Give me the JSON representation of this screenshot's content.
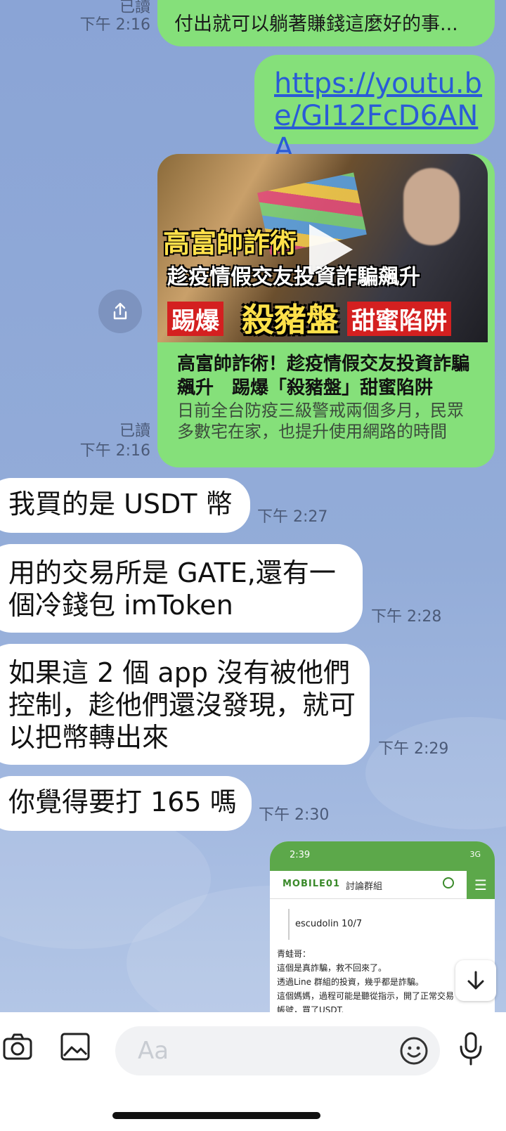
{
  "messages": {
    "m1": {
      "text": "付出就可以躺著賺錢這麼好的事...",
      "read": "已讀",
      "time": "下午 2:16"
    },
    "m2": {
      "link": "https://youtu.be/GI12FcD6ANA"
    },
    "m3": {
      "thumb_title1": "高富帥詐術",
      "thumb_title2": "趁疫情假交友投資詐騙飆升",
      "thumb_title3a": "踢爆",
      "thumb_title3b": "殺豬盤",
      "thumb_title3c": "甜蜜陷阱",
      "title": "高富帥詐術！趁疫情假交友投資詐騙飆升　踢爆「殺豬盤」甜蜜陷阱",
      "desc": "日前全台防疫三級警戒兩個多月，民眾多數宅在家，也提升使用網路的時間",
      "read": "已讀",
      "time": "下午 2:16"
    },
    "m4": {
      "text": "我買的是 USDT 幣",
      "time": "下午 2:27"
    },
    "m5": {
      "text": "用的交易所是 GATE,還有一個冷錢包 imToken",
      "time": "下午 2:28"
    },
    "m6": {
      "text": "如果這 2 個 app 沒有被他們控制，趁他們還沒發現，就可以把幣轉出來",
      "time": "下午 2:29"
    },
    "m7": {
      "text": "你覺得要打 165 嗎",
      "time": "下午 2:30"
    },
    "m8": {
      "status_time": "2:39",
      "status_signal": "3G",
      "site_logo": "MOBILE01",
      "site_section": "討論群組",
      "author": "escudolin 10/7",
      "lines": [
        "青蛙哥：",
        "這個是真詐騙，救不回來了。",
        "透過Line 群組的投資，幾乎都是詐騙。",
        "這個媽媽，過程可能是聽從指示，開了正常交易",
        "帳號，買了USDT."
      ]
    }
  },
  "input": {
    "placeholder": "Aa"
  },
  "icons": [
    "share-icon",
    "scroll-down-icon",
    "camera-icon",
    "image-icon",
    "emoji-icon",
    "microphone-icon",
    "play-icon"
  ],
  "colors": {
    "chat_bg": "#8ea8d6",
    "sent_bubble": "#85e07a",
    "received_bubble": "#ffffff",
    "link": "#2a5bd7"
  }
}
